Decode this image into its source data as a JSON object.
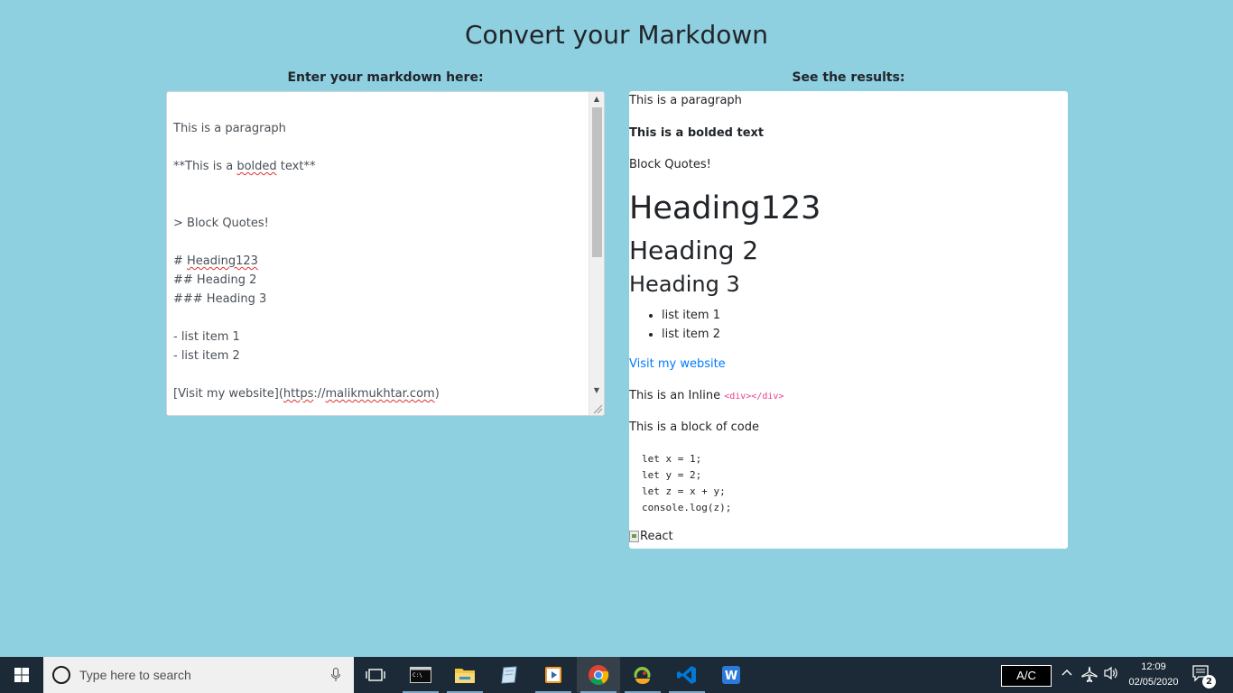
{
  "page": {
    "title": "Convert your Markdown"
  },
  "editor": {
    "label": "Enter your markdown here:",
    "lines": {
      "l1": "This is a paragraph",
      "l2_pre": "**This is a ",
      "l2_word": "bolded",
      "l2_post": " text**",
      "l3": "> Block Quotes!",
      "l4_pre": "# ",
      "l4_word": "Heading123",
      "l5": "## Heading 2",
      "l6": "### Heading 3",
      "l7": "- list item 1",
      "l8": "- list item 2",
      "l9_pre": "[Visit my website](",
      "l9_w1": "https",
      "l9_mid": "://",
      "l9_w2": "malikmukhtar.com",
      "l9_post": ")"
    }
  },
  "preview": {
    "label": "See the results:",
    "paragraph": "This is a paragraph",
    "bold": "This is a bolded text",
    "blockquote": "Block Quotes!",
    "h1": "Heading123",
    "h2": "Heading 2",
    "h3": "Heading 3",
    "list": [
      "list item 1",
      "list item 2"
    ],
    "link": "Visit my website",
    "inline_text": "This is an Inline ",
    "inline_code": "<div></div>",
    "block_intro": "This is a block of code",
    "code": "let x = 1;\nlet y = 2;\nlet z = x + y;\nconsole.log(z);",
    "image_alt": "React"
  },
  "taskbar": {
    "search_placeholder": "Type here to search",
    "ac_label": "A/C",
    "time": "12:09",
    "date": "02/05/2020",
    "notification_count": "2",
    "colors": {
      "bar": "#1b2a36",
      "search": "#f0f0f0"
    }
  },
  "colors": {
    "background": "#8ecfe0",
    "link": "#007bff",
    "code": "#e83e8c"
  }
}
